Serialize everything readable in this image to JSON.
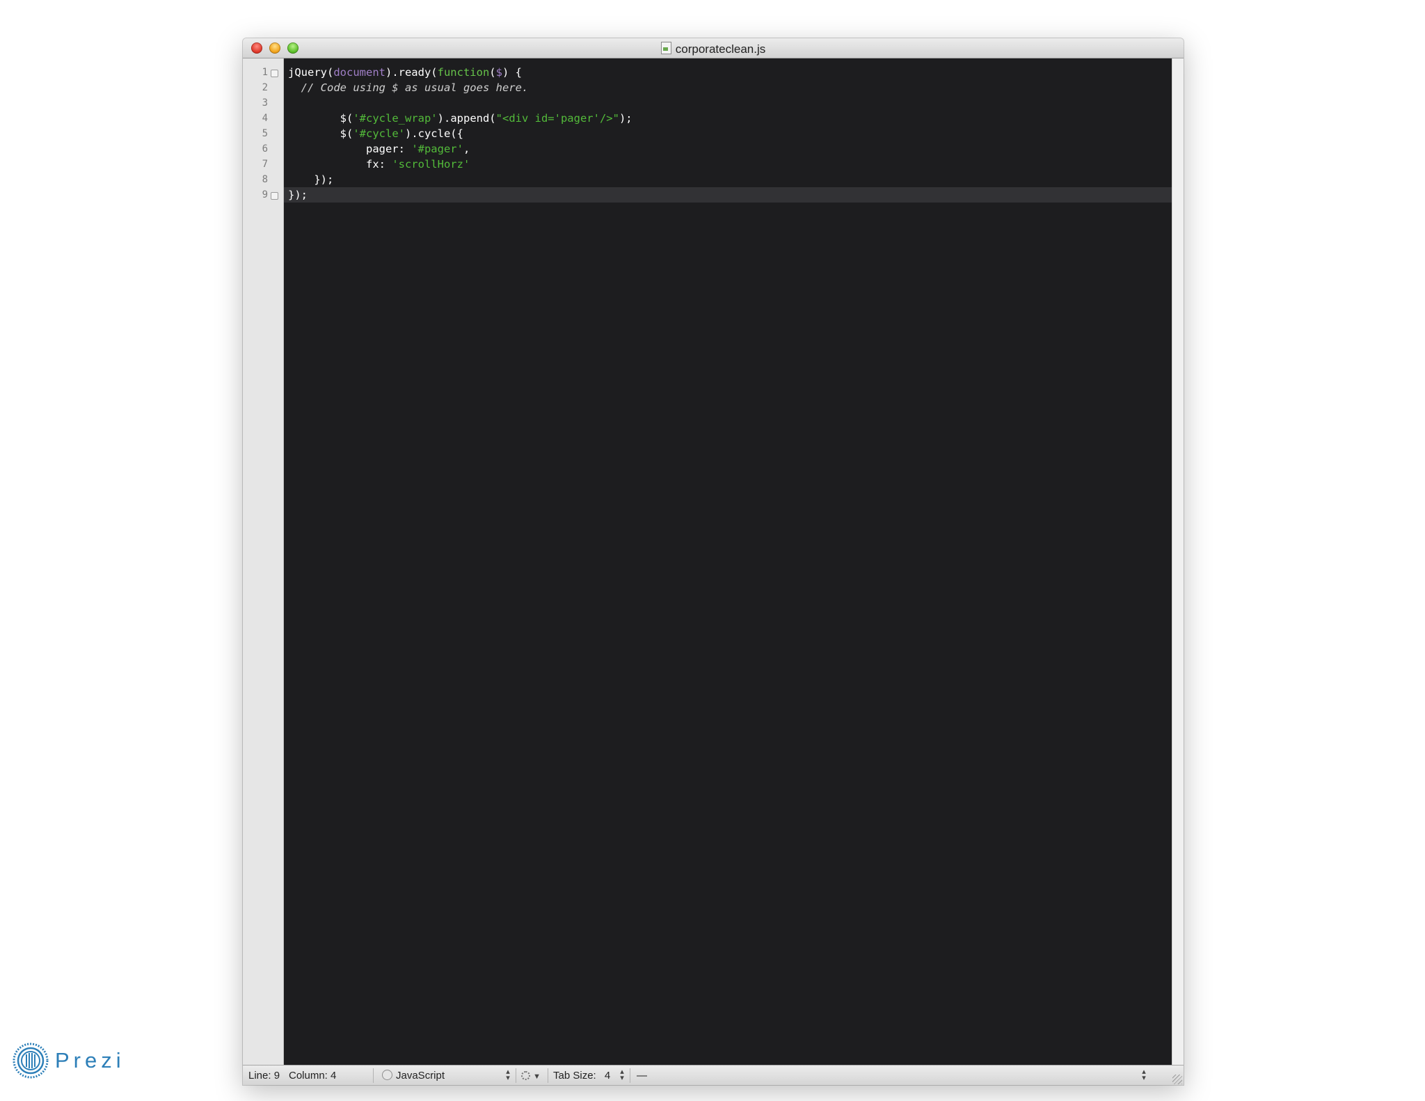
{
  "window": {
    "title": "corporateclean.js"
  },
  "gutter": {
    "line_numbers": [
      "1",
      "2",
      "3",
      "4",
      "5",
      "6",
      "7",
      "8",
      "9"
    ]
  },
  "editor": {
    "current_line_index": 9,
    "lines": [
      [
        [
          "jQuery(",
          "white"
        ],
        [
          "document",
          "purple"
        ],
        [
          ").ready(",
          "white"
        ],
        [
          "function",
          "green"
        ],
        [
          "(",
          "white"
        ],
        [
          "$",
          "purple"
        ],
        [
          ") {",
          "white"
        ]
      ],
      [
        [
          "  // Code using $ as usual goes here.",
          "comment"
        ]
      ],
      [],
      [
        [
          "        $(",
          "white"
        ],
        [
          "'#cycle_wrap'",
          "string"
        ],
        [
          ").append(",
          "white"
        ],
        [
          "\"<div id='pager'/>\"",
          "string"
        ],
        [
          ");",
          "white"
        ]
      ],
      [
        [
          "        $(",
          "white"
        ],
        [
          "'#cycle'",
          "string"
        ],
        [
          ").cycle({",
          "white"
        ]
      ],
      [
        [
          "            pager: ",
          "white"
        ],
        [
          "'#pager'",
          "string"
        ],
        [
          ",",
          "white"
        ]
      ],
      [
        [
          "            fx: ",
          "white"
        ],
        [
          "'scrollHorz'",
          "string"
        ]
      ],
      [
        [
          "    });",
          "white"
        ]
      ],
      [
        [
          "});",
          "white"
        ]
      ]
    ]
  },
  "statusbar": {
    "line_label": "Line:",
    "line_value": "9",
    "column_label": "Column:",
    "column_value": "4",
    "language": "JavaScript",
    "tab_size_label": "Tab Size:",
    "tab_size_value": "4",
    "symbol": "—"
  },
  "branding": {
    "logo_text": "Prezi"
  },
  "colors": {
    "editor_background": "#1d1d1f",
    "keyword_green": "#66c34a",
    "string_green": "#53bb3a",
    "builtin_purple": "#a07fc7",
    "current_line": "#323235",
    "prezi_blue": "#2d7fb8"
  }
}
